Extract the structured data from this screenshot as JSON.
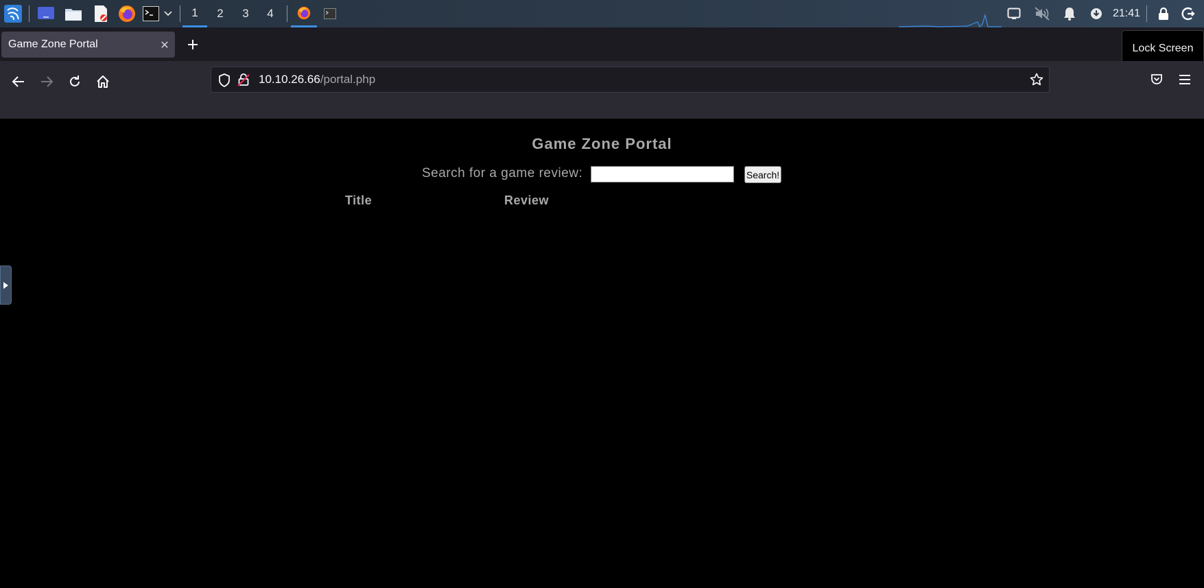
{
  "taskbar": {
    "workspaces": [
      "1",
      "2",
      "3",
      "4"
    ],
    "active_workspace": "1",
    "clock": "21:41",
    "icons": [
      "kali-menu-icon",
      "desktop-icon",
      "files-icon",
      "text-editor-icon",
      "firefox-icon",
      "terminal-icon",
      "dropdown-chevron-icon",
      "firefox-window-icon",
      "terminal-window-icon",
      "display-icon",
      "audio-muted-icon",
      "notifications-icon",
      "updates-icon",
      "lock-icon",
      "logout-icon"
    ]
  },
  "browser": {
    "tab_title": "Game Zone Portal",
    "tooltip": "Lock Screen",
    "url_host": "10.10.26.66",
    "url_path": "/portal.php"
  },
  "page": {
    "title": "Game Zone Portal",
    "search_label": "Search for a game review:",
    "search_value": "",
    "search_button": "Search!",
    "columns": [
      "Title",
      "Review"
    ]
  },
  "colors": {
    "taskbar_bg": "#2c3a4a",
    "browser_chrome": "#2b2a33",
    "tab_strip": "#1c1b22",
    "page_bg": "#000000",
    "page_text": "#a9a9a9",
    "accent": "#3d8ee6"
  }
}
